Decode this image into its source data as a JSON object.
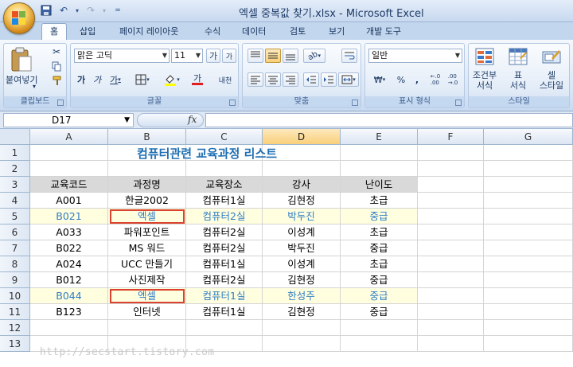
{
  "window": {
    "title": "엑셀 중복값 찾기.xlsx - Microsoft Excel"
  },
  "qat": {
    "icons": [
      "save-icon",
      "undo-icon",
      "redo-icon",
      "customize-icon"
    ]
  },
  "ribbon_tabs": [
    "홈",
    "삽입",
    "페이지 레이아웃",
    "수식",
    "데이터",
    "검토",
    "보기",
    "개발 도구"
  ],
  "ribbon": {
    "clipboard": {
      "paste_label": "붙여넣기",
      "group_label": "클립보드"
    },
    "font": {
      "font_name": "맑은 고딕",
      "font_size": "11",
      "bold": "가",
      "italic": "가",
      "underline": "가",
      "grow": "가",
      "shrink": "가",
      "font_color": "가",
      "phonetic": "내천",
      "group_label": "글꼴"
    },
    "alignment": {
      "group_label": "맞춤"
    },
    "number": {
      "format": "일반",
      "currency": "₩",
      "percent": "%",
      "comma": ",",
      "group_label": "표시 형식"
    },
    "styles": {
      "conditional_line1": "조건부",
      "conditional_line2": "서식",
      "table_line1": "표",
      "table_line2": "서식",
      "cell_line1": "셀",
      "cell_line2": "스타일",
      "group_label": "스타일"
    }
  },
  "formula_bar": {
    "name_box": "D17",
    "fx": "fx",
    "content": ""
  },
  "sheet": {
    "columns": [
      "A",
      "B",
      "C",
      "D",
      "E",
      "F",
      "G"
    ],
    "selected_column": "D",
    "rows": [
      "1",
      "2",
      "3",
      "4",
      "5",
      "6",
      "7",
      "8",
      "9",
      "10",
      "11",
      "12",
      "13"
    ],
    "title": "컴퓨터관련 교육과정 리스트",
    "headers": [
      "교육코드",
      "과정명",
      "교육장소",
      "강사",
      "난이도"
    ],
    "data": [
      [
        "A001",
        "한글2002",
        "컴퓨터1실",
        "김현정",
        "초급"
      ],
      [
        "B021",
        "엑셀",
        "컴퓨터2실",
        "박두진",
        "중급"
      ],
      [
        "A033",
        "파워포인트",
        "컴퓨터2실",
        "이성계",
        "초급"
      ],
      [
        "B022",
        "MS 워드",
        "컴퓨터2실",
        "박두진",
        "중급"
      ],
      [
        "A024",
        "UCC 만들기",
        "컴퓨터1실",
        "이성계",
        "초급"
      ],
      [
        "B012",
        "사진제작",
        "컴퓨터2실",
        "김현정",
        "중급"
      ],
      [
        "B044",
        "엑셀",
        "컴퓨터1실",
        "한성주",
        "중급"
      ],
      [
        "B123",
        "인터넷",
        "컴퓨터1실",
        "김현정",
        "중급"
      ]
    ],
    "highlight_color": "#2f7cc2",
    "highlight_fill": "#ffffe0",
    "duplicate_box_color": "#d9432f"
  },
  "watermark": "http://secstart.tistory.com"
}
